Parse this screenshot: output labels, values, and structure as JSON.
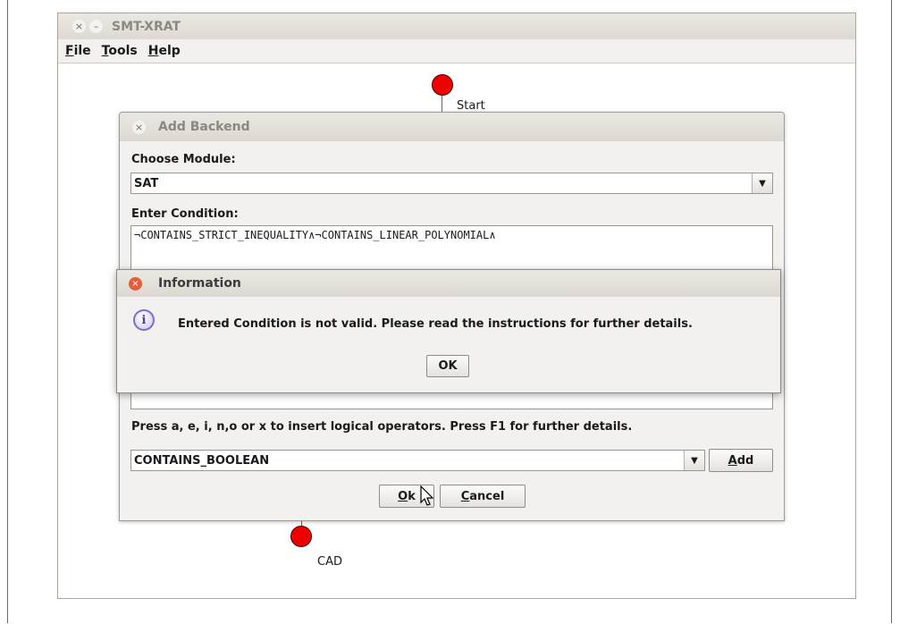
{
  "main_window": {
    "title": "SMT-XRAT",
    "menu": [
      "File",
      "Tools",
      "Help"
    ]
  },
  "graph": {
    "start_label": "Start",
    "cad_label": "CAD",
    "node_color": "#ee0000"
  },
  "add_backend": {
    "title": "Add Backend",
    "module_label": "Choose Module:",
    "module_value": "SAT",
    "condition_label": "Enter Condition:",
    "condition_text": "¬CONTAINS_STRICT_INEQUALITY∧¬CONTAINS_LINEAR_POLYNOMIAL∧",
    "hint": "Press a, e, i, n,o or x to insert logical operators. Press F1 for further details.",
    "property_value": "CONTAINS_BOOLEAN",
    "add_label": "Add",
    "ok_label": "Ok",
    "cancel_label": "Cancel"
  },
  "info_dialog": {
    "title": "Information",
    "message": "Entered Condition is not valid. Please read the instructions for further details.",
    "ok_label": "OK",
    "icon": "info-icon"
  }
}
